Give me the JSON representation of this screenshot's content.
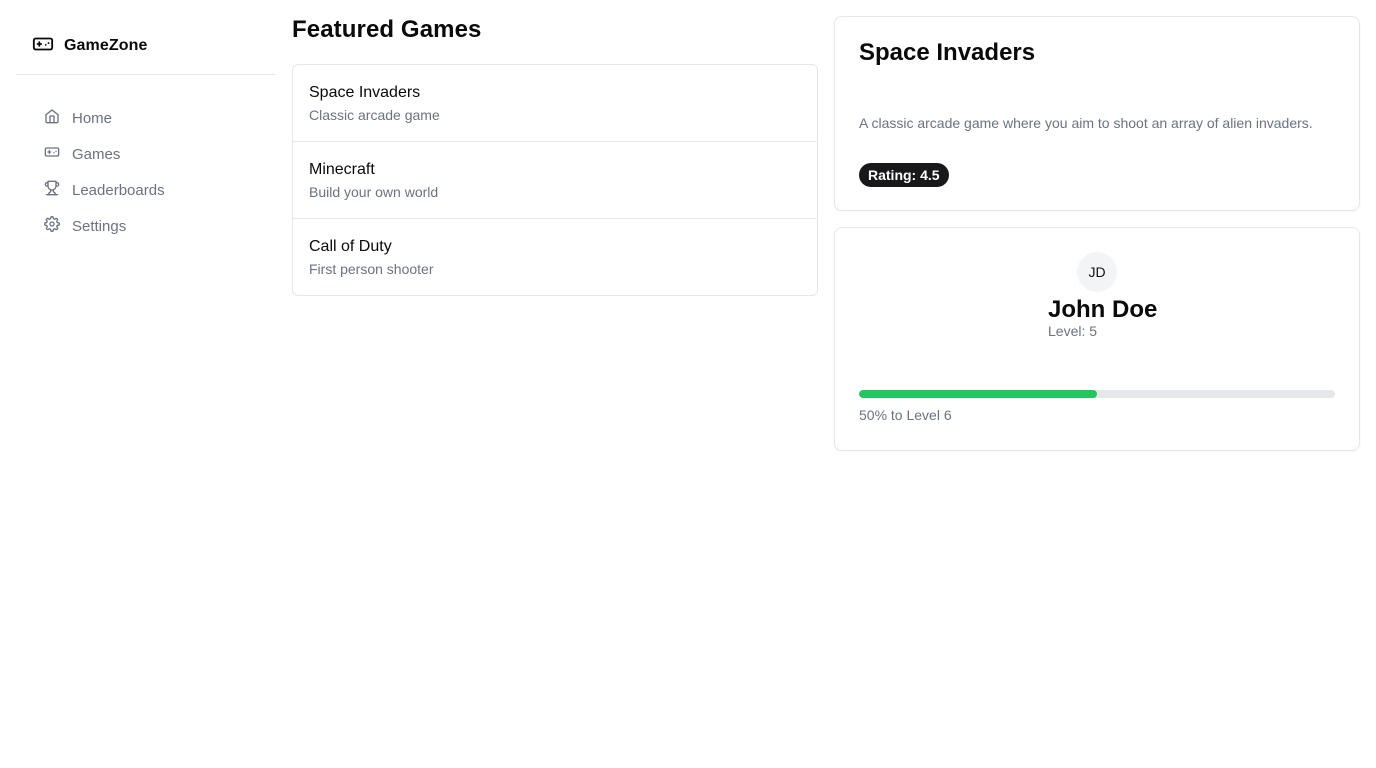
{
  "brand": {
    "name": "GameZone",
    "icon": "gamepad-icon"
  },
  "nav": {
    "items": [
      {
        "label": "Home",
        "icon": "home-icon"
      },
      {
        "label": "Games",
        "icon": "gamepad-icon"
      },
      {
        "label": "Leaderboards",
        "icon": "trophy-icon"
      },
      {
        "label": "Settings",
        "icon": "gear-icon"
      }
    ]
  },
  "main": {
    "title": "Featured Games",
    "games": [
      {
        "name": "Space Invaders",
        "subtitle": "Classic arcade game"
      },
      {
        "name": "Minecraft",
        "subtitle": "Build your own world"
      },
      {
        "name": "Call of Duty",
        "subtitle": "First person shooter"
      }
    ]
  },
  "detail": {
    "title": "Space Invaders",
    "description": "A classic arcade game where you aim to shoot an array of alien invaders.",
    "rating_badge": "Rating: 4.5"
  },
  "profile": {
    "initials": "JD",
    "name": "John Doe",
    "level_text": "Level: 5",
    "progress_percent": 50,
    "progress_text": "50% to Level 6"
  },
  "colors": {
    "accent": "#22c55e",
    "badge_bg": "#18181b",
    "muted_text": "#6b7280",
    "border": "#e5e7eb"
  }
}
